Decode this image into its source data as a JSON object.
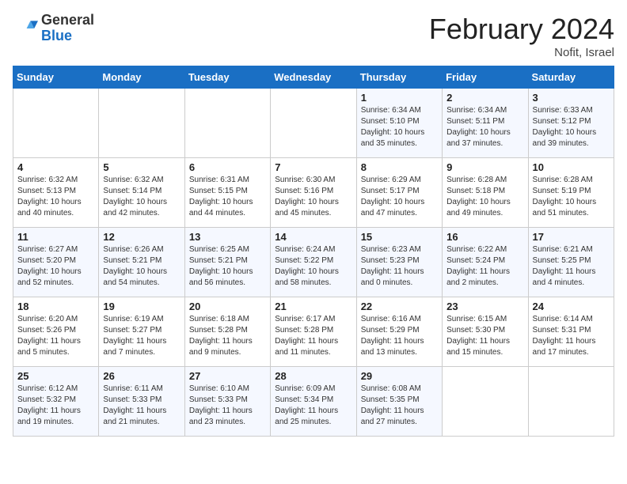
{
  "logo": {
    "general": "General",
    "blue": "Blue"
  },
  "title": "February 2024",
  "subtitle": "Nofit, Israel",
  "weekdays": [
    "Sunday",
    "Monday",
    "Tuesday",
    "Wednesday",
    "Thursday",
    "Friday",
    "Saturday"
  ],
  "weeks": [
    [
      {
        "day": "",
        "info": ""
      },
      {
        "day": "",
        "info": ""
      },
      {
        "day": "",
        "info": ""
      },
      {
        "day": "",
        "info": ""
      },
      {
        "day": "1",
        "info": "Sunrise: 6:34 AM\nSunset: 5:10 PM\nDaylight: 10 hours\nand 35 minutes."
      },
      {
        "day": "2",
        "info": "Sunrise: 6:34 AM\nSunset: 5:11 PM\nDaylight: 10 hours\nand 37 minutes."
      },
      {
        "day": "3",
        "info": "Sunrise: 6:33 AM\nSunset: 5:12 PM\nDaylight: 10 hours\nand 39 minutes."
      }
    ],
    [
      {
        "day": "4",
        "info": "Sunrise: 6:32 AM\nSunset: 5:13 PM\nDaylight: 10 hours\nand 40 minutes."
      },
      {
        "day": "5",
        "info": "Sunrise: 6:32 AM\nSunset: 5:14 PM\nDaylight: 10 hours\nand 42 minutes."
      },
      {
        "day": "6",
        "info": "Sunrise: 6:31 AM\nSunset: 5:15 PM\nDaylight: 10 hours\nand 44 minutes."
      },
      {
        "day": "7",
        "info": "Sunrise: 6:30 AM\nSunset: 5:16 PM\nDaylight: 10 hours\nand 45 minutes."
      },
      {
        "day": "8",
        "info": "Sunrise: 6:29 AM\nSunset: 5:17 PM\nDaylight: 10 hours\nand 47 minutes."
      },
      {
        "day": "9",
        "info": "Sunrise: 6:28 AM\nSunset: 5:18 PM\nDaylight: 10 hours\nand 49 minutes."
      },
      {
        "day": "10",
        "info": "Sunrise: 6:28 AM\nSunset: 5:19 PM\nDaylight: 10 hours\nand 51 minutes."
      }
    ],
    [
      {
        "day": "11",
        "info": "Sunrise: 6:27 AM\nSunset: 5:20 PM\nDaylight: 10 hours\nand 52 minutes."
      },
      {
        "day": "12",
        "info": "Sunrise: 6:26 AM\nSunset: 5:21 PM\nDaylight: 10 hours\nand 54 minutes."
      },
      {
        "day": "13",
        "info": "Sunrise: 6:25 AM\nSunset: 5:21 PM\nDaylight: 10 hours\nand 56 minutes."
      },
      {
        "day": "14",
        "info": "Sunrise: 6:24 AM\nSunset: 5:22 PM\nDaylight: 10 hours\nand 58 minutes."
      },
      {
        "day": "15",
        "info": "Sunrise: 6:23 AM\nSunset: 5:23 PM\nDaylight: 11 hours\nand 0 minutes."
      },
      {
        "day": "16",
        "info": "Sunrise: 6:22 AM\nSunset: 5:24 PM\nDaylight: 11 hours\nand 2 minutes."
      },
      {
        "day": "17",
        "info": "Sunrise: 6:21 AM\nSunset: 5:25 PM\nDaylight: 11 hours\nand 4 minutes."
      }
    ],
    [
      {
        "day": "18",
        "info": "Sunrise: 6:20 AM\nSunset: 5:26 PM\nDaylight: 11 hours\nand 5 minutes."
      },
      {
        "day": "19",
        "info": "Sunrise: 6:19 AM\nSunset: 5:27 PM\nDaylight: 11 hours\nand 7 minutes."
      },
      {
        "day": "20",
        "info": "Sunrise: 6:18 AM\nSunset: 5:28 PM\nDaylight: 11 hours\nand 9 minutes."
      },
      {
        "day": "21",
        "info": "Sunrise: 6:17 AM\nSunset: 5:28 PM\nDaylight: 11 hours\nand 11 minutes."
      },
      {
        "day": "22",
        "info": "Sunrise: 6:16 AM\nSunset: 5:29 PM\nDaylight: 11 hours\nand 13 minutes."
      },
      {
        "day": "23",
        "info": "Sunrise: 6:15 AM\nSunset: 5:30 PM\nDaylight: 11 hours\nand 15 minutes."
      },
      {
        "day": "24",
        "info": "Sunrise: 6:14 AM\nSunset: 5:31 PM\nDaylight: 11 hours\nand 17 minutes."
      }
    ],
    [
      {
        "day": "25",
        "info": "Sunrise: 6:12 AM\nSunset: 5:32 PM\nDaylight: 11 hours\nand 19 minutes."
      },
      {
        "day": "26",
        "info": "Sunrise: 6:11 AM\nSunset: 5:33 PM\nDaylight: 11 hours\nand 21 minutes."
      },
      {
        "day": "27",
        "info": "Sunrise: 6:10 AM\nSunset: 5:33 PM\nDaylight: 11 hours\nand 23 minutes."
      },
      {
        "day": "28",
        "info": "Sunrise: 6:09 AM\nSunset: 5:34 PM\nDaylight: 11 hours\nand 25 minutes."
      },
      {
        "day": "29",
        "info": "Sunrise: 6:08 AM\nSunset: 5:35 PM\nDaylight: 11 hours\nand 27 minutes."
      },
      {
        "day": "",
        "info": ""
      },
      {
        "day": "",
        "info": ""
      }
    ]
  ]
}
